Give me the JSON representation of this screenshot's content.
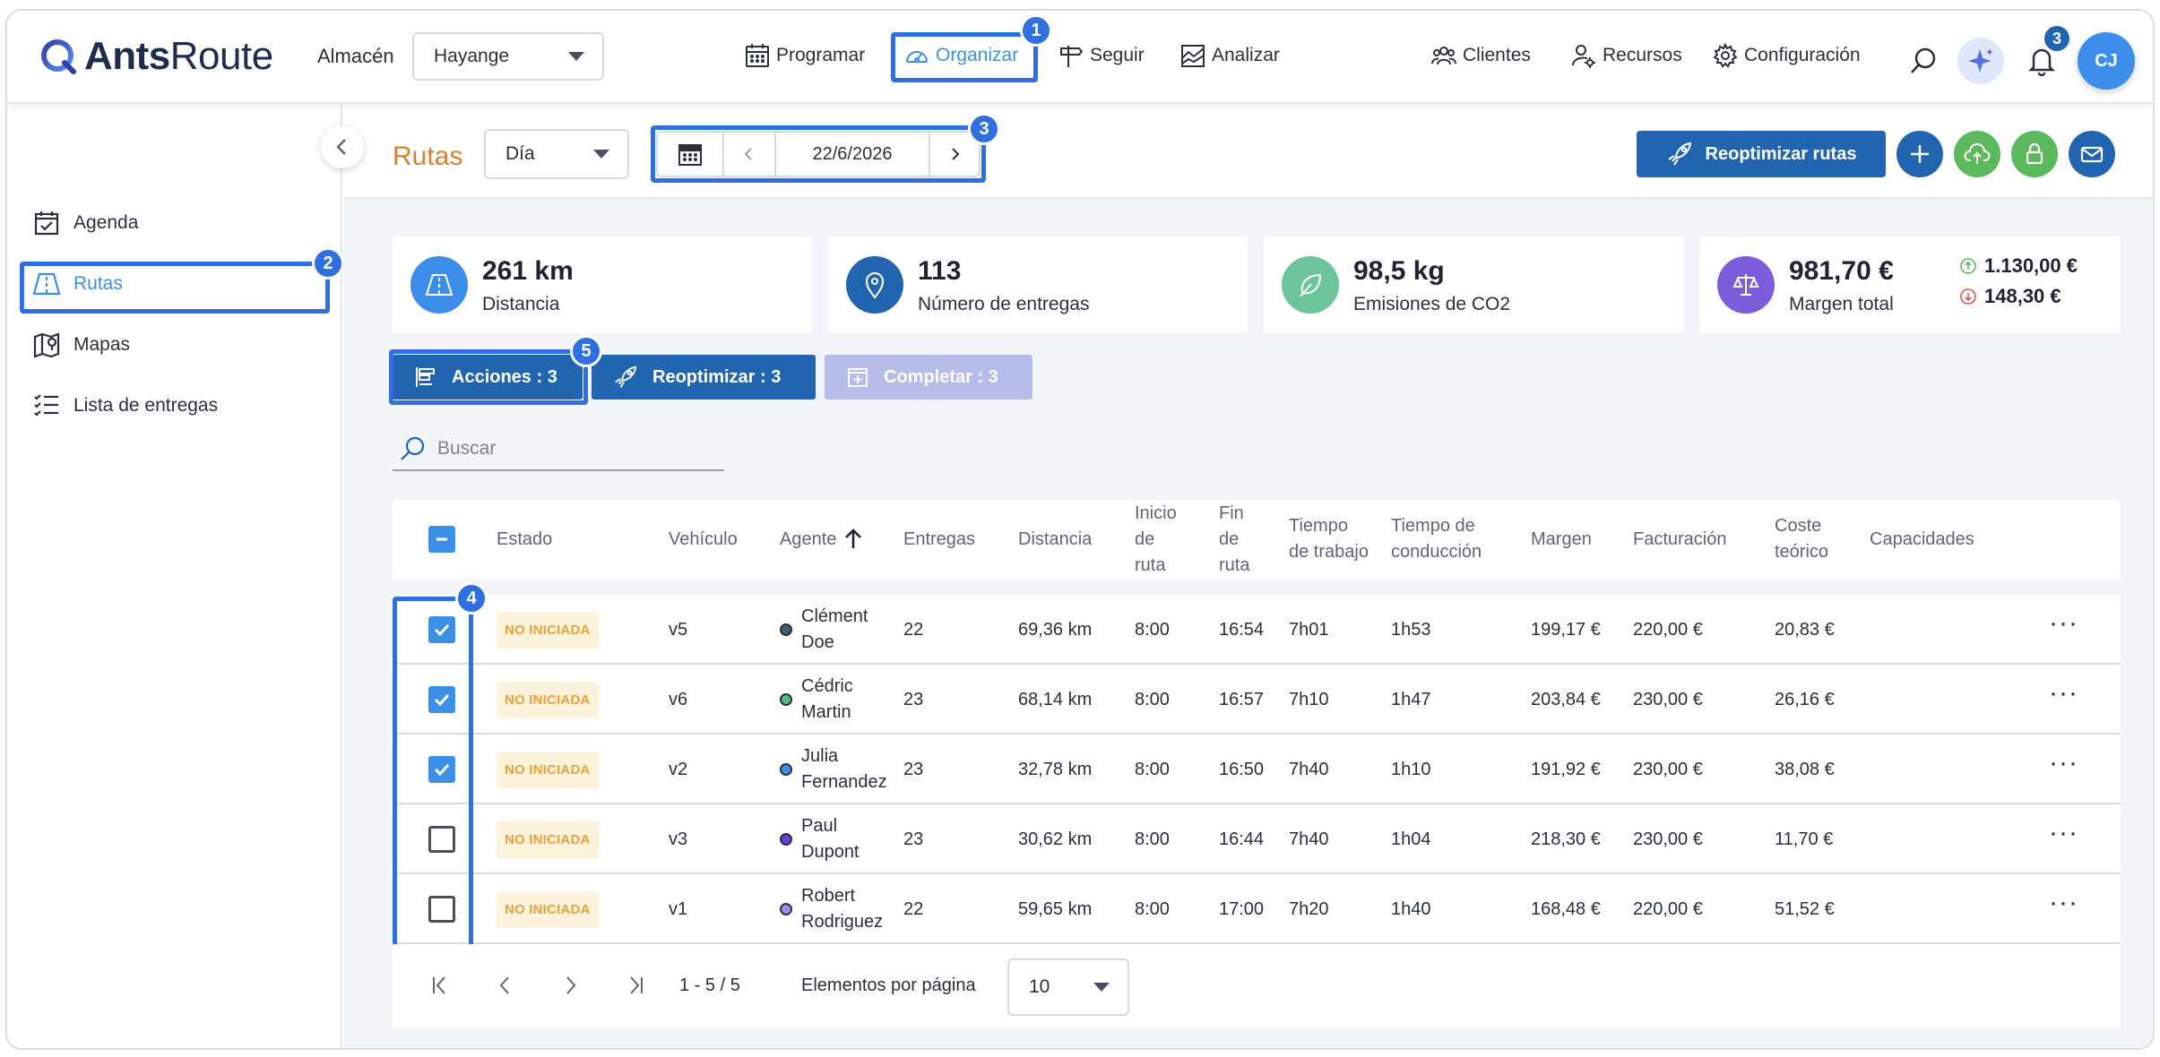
{
  "brand": {
    "name_bold": "Ants",
    "name_regular": "Route"
  },
  "header": {
    "warehouse_label": "Almacén",
    "warehouse_value": "Hayange",
    "nav": [
      {
        "label": "Programar",
        "icon": "calendar-icon"
      },
      {
        "label": "Organizar",
        "icon": "speedometer-icon",
        "active": true
      },
      {
        "label": "Seguir",
        "icon": "signpost-icon"
      },
      {
        "label": "Analizar",
        "icon": "chart-icon"
      },
      {
        "label": "Clientes",
        "icon": "clients-icon"
      },
      {
        "label": "Recursos",
        "icon": "resources-icon"
      },
      {
        "label": "Configuración",
        "icon": "gear-icon"
      }
    ],
    "notifications_count": "3",
    "avatar_initials": "CJ"
  },
  "callouts": {
    "c1": "1",
    "c2": "2",
    "c3": "3",
    "c4": "4",
    "c5": "5"
  },
  "sidebar": {
    "items": [
      {
        "label": "Agenda",
        "icon": "agenda-icon"
      },
      {
        "label": "Rutas",
        "icon": "routes-icon",
        "active": true
      },
      {
        "label": "Mapas",
        "icon": "map-icon"
      },
      {
        "label": "Lista de entregas",
        "icon": "list-icon"
      }
    ]
  },
  "subheader": {
    "title": "Rutas",
    "view_value": "Día",
    "date": "22/6/2026",
    "reoptimize_label": "Reoptimizar rutas"
  },
  "stats": [
    {
      "value": "261 km",
      "label": "Distancia",
      "icon": "road-icon",
      "color": "#3d8eea"
    },
    {
      "value": "113",
      "label": "Número de entregas",
      "icon": "pin-icon",
      "color": "#2165b0"
    },
    {
      "value": "98,5 kg",
      "label": "Emisiones de CO2",
      "icon": "leaf-icon",
      "color": "#6cc49a"
    },
    {
      "value": "981,70 €",
      "label": "Margen total",
      "icon": "scale-icon",
      "color": "#7c5cdb",
      "up": "1.130,00 €",
      "down": "148,30 €"
    }
  ],
  "actions": {
    "acciones": "Acciones : 3",
    "reoptimizar": "Reoptimizar : 3",
    "completar": "Completar : 3"
  },
  "search": {
    "placeholder": "Buscar"
  },
  "table": {
    "headers": {
      "estado": "Estado",
      "vehiculo": "Vehículo",
      "agente": "Agente",
      "entregas": "Entregas",
      "distancia": "Distancia",
      "inicio": "Inicio de ruta",
      "fin": "Fin de ruta",
      "trabajo": "Tiempo de trabajo",
      "conduccion": "Tiempo de conducción",
      "margen": "Margen",
      "facturacion": "Facturación",
      "coste": "Coste teórico",
      "capacidades": "Capacidades"
    },
    "rows": [
      {
        "checked": true,
        "status": "NO INICIADA",
        "vehicle": "v5",
        "agent": "Clément Doe",
        "dot": "#3f5d73",
        "deliveries": "22",
        "distance": "69,36 km",
        "start": "8:00",
        "end": "16:54",
        "work": "7h01",
        "drive": "1h53",
        "margin": "199,17 €",
        "billing": "220,00 €",
        "cost": "20,83 €"
      },
      {
        "checked": true,
        "status": "NO INICIADA",
        "vehicle": "v6",
        "agent": "Cédric Martin",
        "dot": "#4fc07a",
        "deliveries": "23",
        "distance": "68,14 km",
        "start": "8:00",
        "end": "16:57",
        "work": "7h10",
        "drive": "1h47",
        "margin": "203,84 €",
        "billing": "230,00 €",
        "cost": "26,16 €"
      },
      {
        "checked": true,
        "status": "NO INICIADA",
        "vehicle": "v2",
        "agent": "Julia Fernandez",
        "dot": "#3d8eea",
        "deliveries": "23",
        "distance": "32,78 km",
        "start": "8:00",
        "end": "16:50",
        "work": "7h40",
        "drive": "1h10",
        "margin": "191,92 €",
        "billing": "230,00 €",
        "cost": "38,08 €"
      },
      {
        "checked": false,
        "status": "NO INICIADA",
        "vehicle": "v3",
        "agent": "Paul Dupont",
        "dot": "#6a3fd8",
        "deliveries": "23",
        "distance": "30,62 km",
        "start": "8:00",
        "end": "16:44",
        "work": "7h40",
        "drive": "1h04",
        "margin": "218,30 €",
        "billing": "230,00 €",
        "cost": "11,70 €"
      },
      {
        "checked": false,
        "status": "NO INICIADA",
        "vehicle": "v1",
        "agent": "Robert Rodriguez",
        "dot": "#9a8ff0",
        "deliveries": "22",
        "distance": "59,65 km",
        "start": "8:00",
        "end": "17:00",
        "work": "7h20",
        "drive": "1h40",
        "margin": "168,48 €",
        "billing": "220,00 €",
        "cost": "51,52 €"
      }
    ]
  },
  "pagination": {
    "range": "1 - 5 / 5",
    "per_page_label": "Elementos por página",
    "per_page_value": "10"
  }
}
